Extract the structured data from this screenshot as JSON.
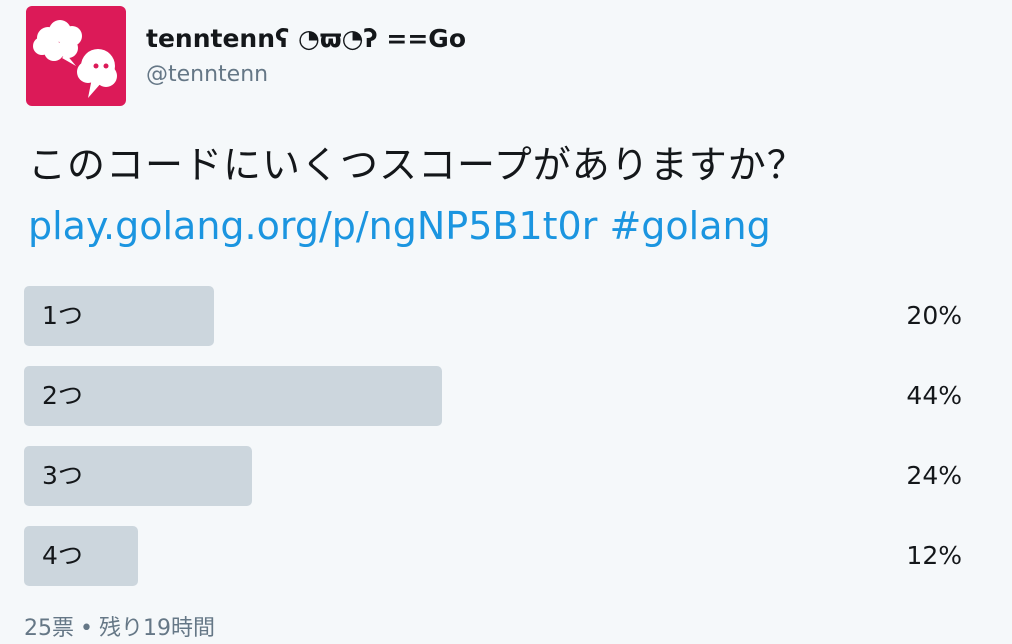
{
  "author": {
    "display_name": "tenntennʕ ◔ϖ◔ʔ ==Go",
    "handle": "@tenntenn"
  },
  "tweet": {
    "text": "このコードにいくつスコープがありますか？",
    "link": "play.golang.org/p/ngNP5B1t0r",
    "hashtag": "#golang"
  },
  "poll": {
    "options": [
      {
        "label": "1つ",
        "percent": 20,
        "percent_label": "20%"
      },
      {
        "label": "2つ",
        "percent": 44,
        "percent_label": "44%"
      },
      {
        "label": "3つ",
        "percent": 24,
        "percent_label": "24%"
      },
      {
        "label": "4つ",
        "percent": 12,
        "percent_label": "12%"
      }
    ],
    "votes": "25票",
    "separator": "•",
    "time_left": "残り19時間"
  },
  "colors": {
    "avatar_bg": "#dc1a58",
    "bar": "#ccd6dd",
    "link": "#1b95e0",
    "muted": "#657786"
  }
}
